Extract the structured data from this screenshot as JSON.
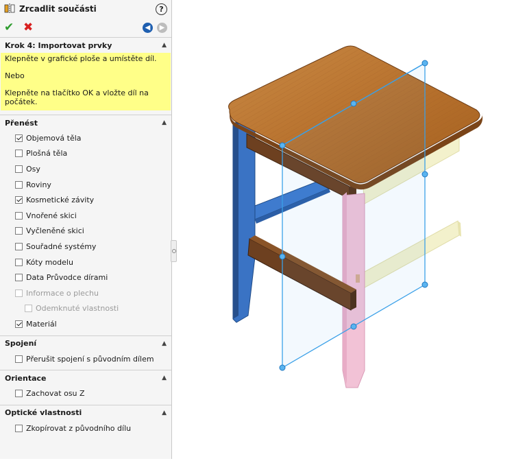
{
  "panel": {
    "title": "Zrcadlit součásti",
    "help_icon": "?",
    "icons": {
      "title": "mirror-component-icon",
      "ok": "check-icon",
      "cancel": "x-icon",
      "back": "back-arrow-icon",
      "forward": "forward-arrow-icon"
    }
  },
  "step": {
    "header": "Krok 4: Importovat prvky",
    "msg1": "Klepněte v grafické ploše a umístěte díl.",
    "msg2": "Nebo",
    "msg3": "Klepněte na tlačítko OK a vložte díl na počátek."
  },
  "transfer": {
    "header": "Přenést",
    "items": [
      {
        "label": "Objemová těla",
        "checked": true
      },
      {
        "label": "Plošná těla",
        "checked": false
      },
      {
        "label": "Osy",
        "checked": false
      },
      {
        "label": "Roviny",
        "checked": false
      },
      {
        "label": "Kosmetické závity",
        "checked": true
      },
      {
        "label": "Vnořené skici",
        "checked": false
      },
      {
        "label": "Vyčleněné skici",
        "checked": false
      },
      {
        "label": "Souřadné systémy",
        "checked": false
      },
      {
        "label": "Kóty modelu",
        "checked": false
      },
      {
        "label": "Data Průvodce dírami",
        "checked": false
      },
      {
        "label": "Informace o plechu",
        "checked": false,
        "disabled": true
      },
      {
        "label": "Odemknuté vlastnosti",
        "checked": false,
        "disabled": true,
        "indent": true
      },
      {
        "label": "Materiál",
        "checked": true
      }
    ]
  },
  "links": {
    "header": "Spojení",
    "items": [
      {
        "label": "Přerušit spojení s původním dílem",
        "checked": false
      }
    ]
  },
  "orientation": {
    "header": "Orientace",
    "items": [
      {
        "label": "Zachovat osu Z",
        "checked": false
      }
    ]
  },
  "optical": {
    "header": "Optické vlastnosti",
    "items": [
      {
        "label": "Zkopírovat z původního dílu",
        "checked": false
      }
    ]
  },
  "colors": {
    "seat": "#b8722e",
    "seat_edge": "#7a4418",
    "blue_leg": "#3a73c4",
    "blue_dark": "#264f8c",
    "pink_leg": "#f2c2d6",
    "yellow_ghost": "#f2f0c8",
    "wood_rail": "#6d4020",
    "plane": "#3aa0e8"
  }
}
